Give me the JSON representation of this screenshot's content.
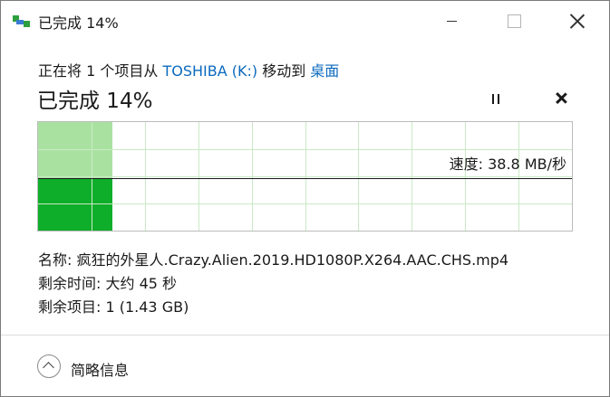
{
  "window": {
    "title": "已完成 14%",
    "icon": "file-copy-icon",
    "controls": {
      "minimize": "minimize-icon",
      "maximize": "maximize-icon",
      "close": "close-icon"
    }
  },
  "header": {
    "prefix": "正在将 1 个项目从 ",
    "source": "TOSHIBA (K:)",
    "middle": " 移动到 ",
    "destination": "桌面",
    "link_color": "#0b6abf"
  },
  "status": {
    "text": "已完成 14%",
    "progress_percent": 14,
    "pause_icon": "pause-icon",
    "cancel_icon": "cancel-icon"
  },
  "graph": {
    "speed_text": "速度: 38.8 MB/秒",
    "fill_color": "#0fae2a",
    "history_color": "#a9e2a0",
    "grid_color": "#c9eac5",
    "speed_level": 0.48
  },
  "details": {
    "name": "名称: 疯狂的外星人.Crazy.Alien.2019.HD1080P.X264.AAC.CHS.mp4",
    "time_left": "剩余时间: 大约 45 秒",
    "items_left": "剩余项目: 1 (1.43 GB)"
  },
  "footer": {
    "toggle_label": "简略信息",
    "toggle_icon": "chevron-up-icon"
  }
}
